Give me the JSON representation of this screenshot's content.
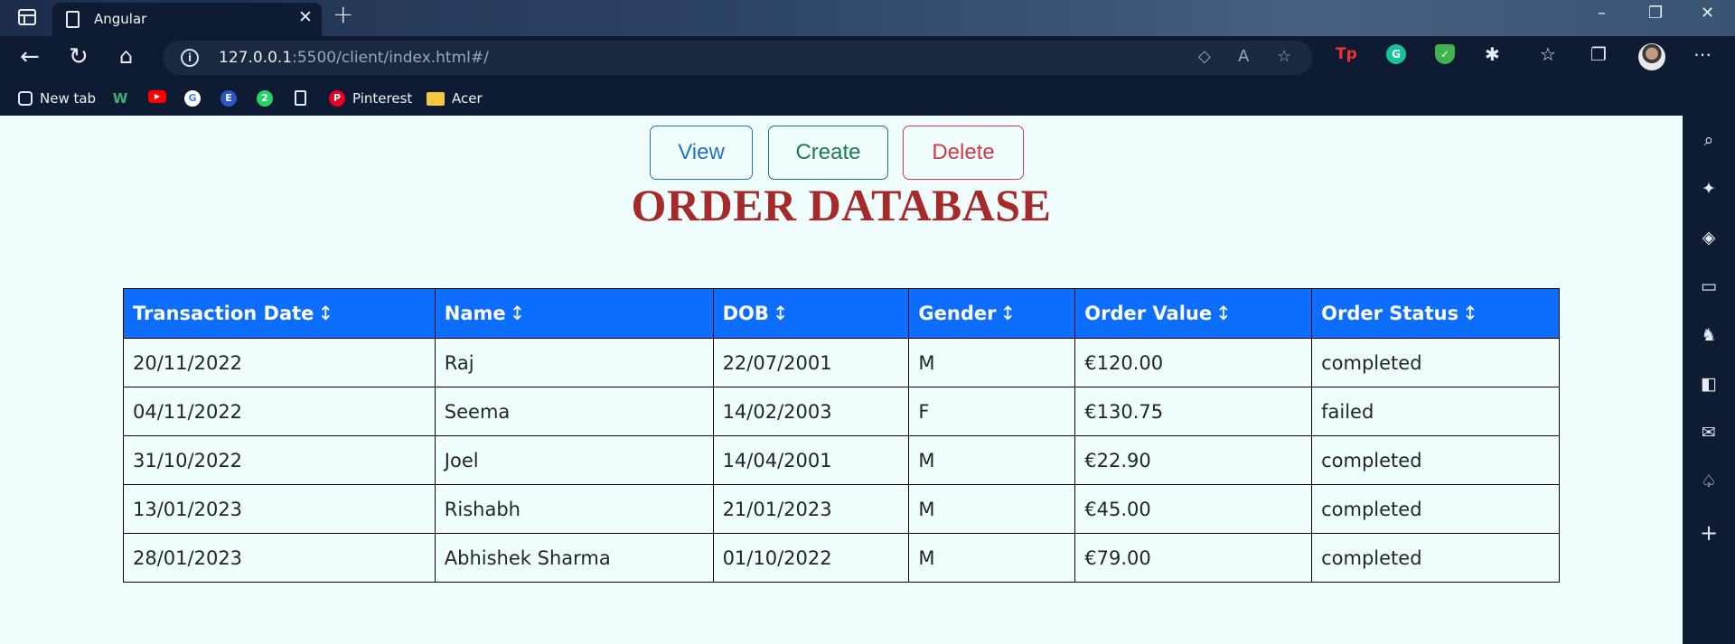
{
  "browser": {
    "tab_title": "Angular",
    "tab_close": "✕",
    "new_tab": "+",
    "url_host": "127.0.0.1",
    "url_rest": ":5500/client/index.html#/",
    "window_controls": [
      "–",
      "❐",
      "✕"
    ],
    "bookmarks": [
      {
        "label": "New tab",
        "icon": "new-tab-icon"
      },
      {
        "label": "",
        "icon": "wordtune-icon"
      },
      {
        "label": "",
        "icon": "youtube-icon"
      },
      {
        "label": "",
        "icon": "google-icon"
      },
      {
        "label": "",
        "icon": "e-icon"
      },
      {
        "label": "",
        "icon": "whatsapp-icon"
      },
      {
        "label": "",
        "icon": "page-icon"
      },
      {
        "label": "Pinterest",
        "icon": "pinterest-icon"
      },
      {
        "label": "Acer",
        "icon": "folder-icon"
      }
    ]
  },
  "actions": {
    "view_label": "View",
    "create_label": "Create",
    "delete_label": "Delete"
  },
  "page": {
    "title": "ORDER DATABASE"
  },
  "table": {
    "sort_glyph": "↕",
    "columns": [
      "Transaction Date",
      "Name",
      "DOB",
      "Gender",
      "Order Value",
      "Order Status"
    ],
    "rows": [
      [
        "20/11/2022",
        "Raj",
        "22/07/2001",
        "M",
        "€120.00",
        "completed"
      ],
      [
        "04/11/2022",
        "Seema",
        "14/02/2003",
        "F",
        "€130.75",
        "failed"
      ],
      [
        "31/10/2022",
        "Joel",
        "14/04/2001",
        "M",
        "€22.90",
        "completed"
      ],
      [
        "13/01/2023",
        "Rishabh",
        "21/01/2023",
        "M",
        "€45.00",
        "completed"
      ],
      [
        "28/01/2023",
        "Abhishek Sharma",
        "01/10/2022",
        "M",
        "€79.00",
        "completed"
      ]
    ]
  },
  "colors": {
    "header_bg": "#0d6efd",
    "title": "#a52a2a",
    "view": "#2271c6",
    "create": "#1f7a4d",
    "delete": "#d13a47"
  }
}
